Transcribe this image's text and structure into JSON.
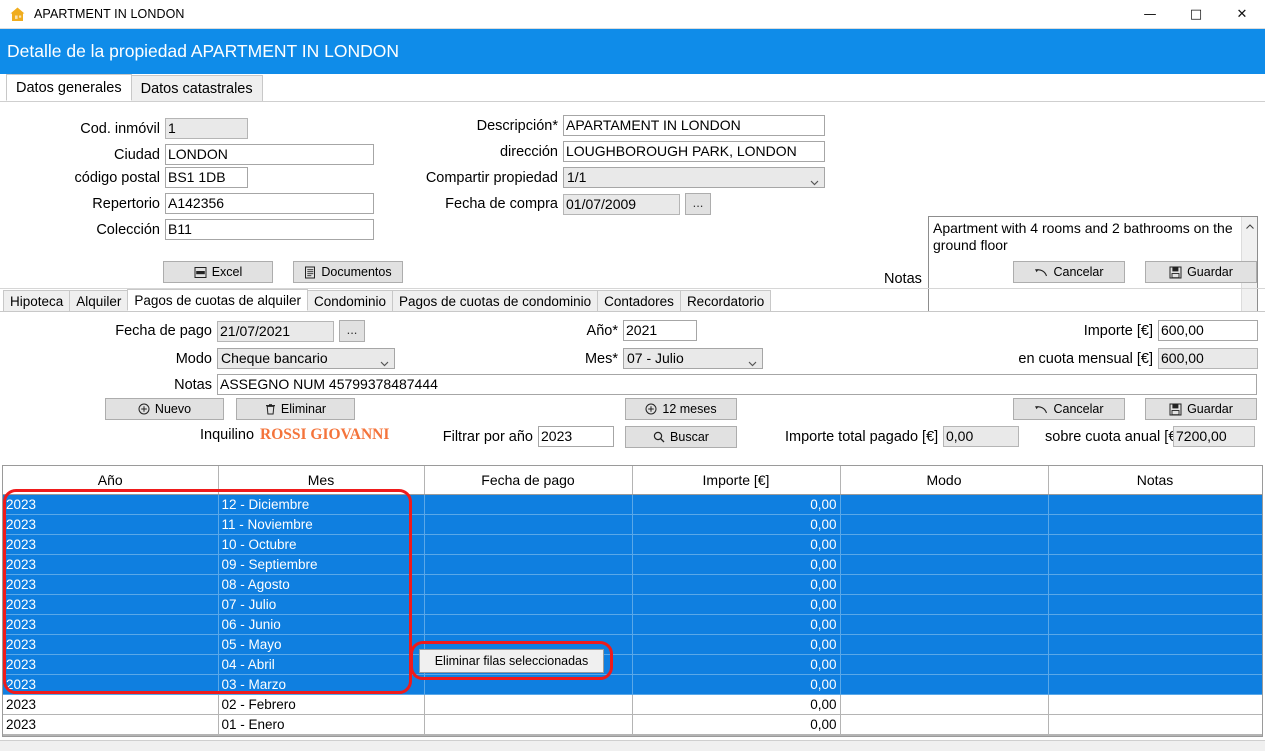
{
  "window": {
    "title": "APARTMENT IN LONDON",
    "icon": "house-icon",
    "minimize": "—",
    "maximize": "□",
    "close": "✕"
  },
  "header": {
    "title": "Detalle de la propiedad APARTMENT IN LONDON",
    "accent_color": "#0f8ce9"
  },
  "outer_tabs": [
    {
      "label": "Datos generales",
      "active": true
    },
    {
      "label": "Datos catastrales",
      "active": false
    }
  ],
  "general": {
    "fields_left": [
      {
        "label": "Cod. inmóvil",
        "value": "1",
        "readonly": true
      },
      {
        "label": "Ciudad",
        "value": "LONDON",
        "readonly": false
      },
      {
        "label": "código postal",
        "value": "BS1 1DB",
        "readonly": false
      },
      {
        "label": "Repertorio",
        "value": "A142356",
        "readonly": false
      },
      {
        "label": "Colección",
        "value": "B11",
        "readonly": false
      }
    ],
    "fields_mid": [
      {
        "label": "Descripción*",
        "value": "APARTAMENT IN LONDON"
      },
      {
        "label": "dirección",
        "value": "LOUGHBOROUGH PARK, LONDON"
      },
      {
        "label": "Compartir propiedad",
        "value": "1/1"
      },
      {
        "label": "Fecha de compra",
        "value": "01/07/2009"
      }
    ],
    "date_picker_button": "...",
    "notes_label": "Notas",
    "notes_value": "Apartment with 4 rooms and 2 bathrooms on the ground floor"
  },
  "toolbar": {
    "excel_label": "Excel",
    "documentos_label": "Documentos",
    "cancelar_label": "Cancelar",
    "guardar_label": "Guardar"
  },
  "inner_tabs": [
    {
      "label": "Hipoteca",
      "active": false
    },
    {
      "label": "Alquiler",
      "active": false
    },
    {
      "label": "Pagos de cuotas de alquiler",
      "active": true
    },
    {
      "label": "Condominio",
      "active": false
    },
    {
      "label": "Pagos de cuotas de condominio",
      "active": false
    },
    {
      "label": "Contadores",
      "active": false
    },
    {
      "label": "Recordatorio",
      "active": false
    }
  ],
  "payment_form": {
    "fecha_pago_label": "Fecha de pago",
    "fecha_pago_value": "21/07/2021",
    "fecha_pago_button": "...",
    "modo_label": "Modo",
    "modo_value": "Cheque bancario",
    "notas_label": "Notas",
    "notas_value": "ASSEGNO NUM 45799378487444",
    "anio_label": "Año*",
    "anio_value": "2021",
    "mes_label": "Mes*",
    "mes_value": "07 - Julio",
    "importe_label": "Importe [€]",
    "importe_value": "600,00",
    "cuota_mensual_label": "en cuota mensual [€]",
    "cuota_mensual_value": "600,00"
  },
  "payment_actions": {
    "nuevo_label": "Nuevo",
    "eliminar_label": "Eliminar",
    "doce_meses_label": "12 meses",
    "cancelar_label": "Cancelar",
    "guardar_label": "Guardar"
  },
  "filter_bar": {
    "inquilino_label": "Inquilino",
    "inquilino_name": "ROSSI GIOVANNI",
    "inquilino_color": "#f4743b",
    "filtrar_label": "Filtrar por año",
    "filtrar_value": "2023",
    "buscar_label": "Buscar",
    "total_pagado_label": "Importe total pagado [€]",
    "total_pagado_value": "0,00",
    "cuota_anual_label": "sobre cuota anual [€]",
    "cuota_anual_value": "7200,00"
  },
  "table": {
    "columns": [
      "Año",
      "Mes",
      "Fecha de pago",
      "Importe [€]",
      "Modo",
      "Notas"
    ],
    "rows": [
      {
        "anio": "2023",
        "mes": "12 - Diciembre",
        "fecha": "",
        "importe": "0,00",
        "modo": "",
        "notas": "",
        "selected": true
      },
      {
        "anio": "2023",
        "mes": "11 - Noviembre",
        "fecha": "",
        "importe": "0,00",
        "modo": "",
        "notas": "",
        "selected": true
      },
      {
        "anio": "2023",
        "mes": "10 - Octubre",
        "fecha": "",
        "importe": "0,00",
        "modo": "",
        "notas": "",
        "selected": true
      },
      {
        "anio": "2023",
        "mes": "09 - Septiembre",
        "fecha": "",
        "importe": "0,00",
        "modo": "",
        "notas": "",
        "selected": true
      },
      {
        "anio": "2023",
        "mes": "08 - Agosto",
        "fecha": "",
        "importe": "0,00",
        "modo": "",
        "notas": "",
        "selected": true
      },
      {
        "anio": "2023",
        "mes": "07 - Julio",
        "fecha": "",
        "importe": "0,00",
        "modo": "",
        "notas": "",
        "selected": true
      },
      {
        "anio": "2023",
        "mes": "06 - Junio",
        "fecha": "",
        "importe": "0,00",
        "modo": "",
        "notas": "",
        "selected": true
      },
      {
        "anio": "2023",
        "mes": "05 - Mayo",
        "fecha": "",
        "importe": "0,00",
        "modo": "",
        "notas": "",
        "selected": true
      },
      {
        "anio": "2023",
        "mes": "04 - Abril",
        "fecha": "",
        "importe": "0,00",
        "modo": "",
        "notas": "",
        "selected": true
      },
      {
        "anio": "2023",
        "mes": "03 - Marzo",
        "fecha": "",
        "importe": "0,00",
        "modo": "",
        "notas": "",
        "selected": true
      },
      {
        "anio": "2023",
        "mes": "02 - Febrero",
        "fecha": "",
        "importe": "0,00",
        "modo": "",
        "notas": "",
        "selected": false
      },
      {
        "anio": "2023",
        "mes": "01 - Enero",
        "fecha": "",
        "importe": "0,00",
        "modo": "",
        "notas": "",
        "selected": false
      }
    ]
  },
  "context_action": {
    "label": "Eliminar filas seleccionadas",
    "highlight_color": "#ef1b1b"
  }
}
